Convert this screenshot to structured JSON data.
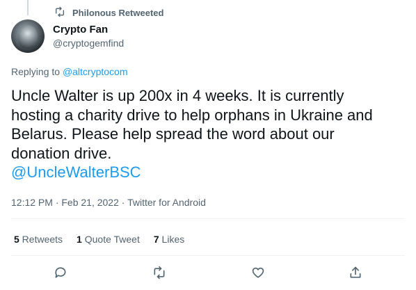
{
  "retweet_banner": {
    "text": "Philonous Retweeted",
    "icon": "retweet-icon"
  },
  "author": {
    "name": "Crypto Fan",
    "handle": "@cryptogemfind"
  },
  "replying": {
    "prefix": "Replying to ",
    "handle": "@altcryptocom"
  },
  "tweet": {
    "text": "Uncle Walter is up 200x in 4 weeks. It is currently\nhosting a charity drive to help orphans in Ukraine and\nBelarus.  Please help spread the word about our\ndonation drive.",
    "mention": "@UncleWalterBSC"
  },
  "meta": {
    "text": "12:12 PM · Feb 21, 2022 · Twitter for Android"
  },
  "stats": [
    {
      "count": "5",
      "label": " Retweets"
    },
    {
      "count": "1",
      "label": " Quote Tweet"
    },
    {
      "count": "7",
      "label": " Likes"
    }
  ],
  "actions": [
    "reply-icon",
    "retweet-icon",
    "like-icon",
    "share-icon"
  ],
  "colors": {
    "link": "#1d9bf0",
    "secondary": "#536471",
    "text": "#0f1419"
  }
}
